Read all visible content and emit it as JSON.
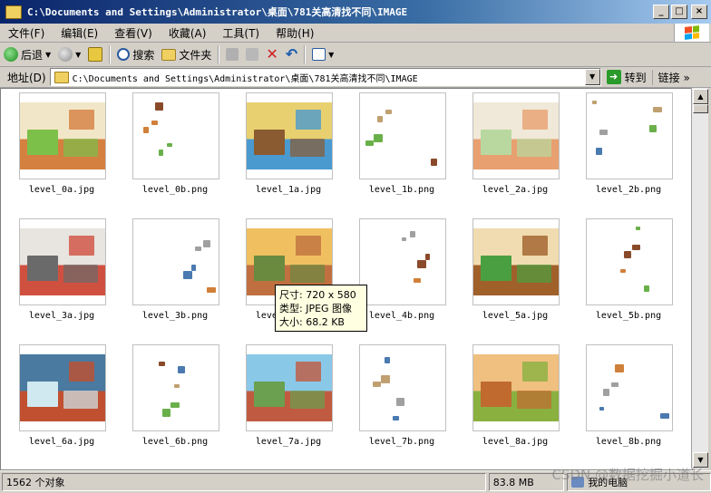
{
  "window": {
    "title": "C:\\Documents and Settings\\Administrator\\桌面\\781关高清找不同\\IMAGE",
    "minimize": "_",
    "maximize": "□",
    "close": "×"
  },
  "menu": [
    "文件(F)",
    "编辑(E)",
    "查看(V)",
    "收藏(A)",
    "工具(T)",
    "帮助(H)"
  ],
  "toolbar": {
    "back_label": "后退",
    "search_label": "搜索",
    "folders_label": "文件夹"
  },
  "address": {
    "label": "地址(D)",
    "path": "C:\\Documents and Settings\\Administrator\\桌面\\781关高清找不同\\IMAGE",
    "go_label": "转到",
    "links_label": "链接"
  },
  "files": [
    {
      "name": "level_0a.jpg",
      "kind": "scene",
      "palette": [
        "#f2e6c8",
        "#7cc04a",
        "#d48040"
      ]
    },
    {
      "name": "level_0b.png",
      "kind": "pieces"
    },
    {
      "name": "level_1a.jpg",
      "kind": "scene",
      "palette": [
        "#e8d070",
        "#8a5a30",
        "#4a9ad0"
      ]
    },
    {
      "name": "level_1b.png",
      "kind": "pieces"
    },
    {
      "name": "level_2a.jpg",
      "kind": "scene",
      "palette": [
        "#f0e8d8",
        "#b8d8a0",
        "#e8a070"
      ]
    },
    {
      "name": "level_2b.png",
      "kind": "pieces"
    },
    {
      "name": "level_3a.jpg",
      "kind": "scene",
      "palette": [
        "#e8e4e0",
        "#6a6a6a",
        "#d05040"
      ]
    },
    {
      "name": "level_3b.png",
      "kind": "pieces"
    },
    {
      "name": "level_4a.jpg",
      "kind": "scene",
      "palette": [
        "#f0c060",
        "#6a8a40",
        "#c07040"
      ]
    },
    {
      "name": "level_4b.png",
      "kind": "pieces"
    },
    {
      "name": "level_5a.jpg",
      "kind": "scene",
      "palette": [
        "#f0dcb0",
        "#4aa040",
        "#a0602a"
      ]
    },
    {
      "name": "level_5b.png",
      "kind": "pieces"
    },
    {
      "name": "level_6a.jpg",
      "kind": "scene",
      "palette": [
        "#4a7aa0",
        "#d0e8f0",
        "#c05030"
      ]
    },
    {
      "name": "level_6b.png",
      "kind": "pieces"
    },
    {
      "name": "level_7a.jpg",
      "kind": "scene",
      "palette": [
        "#8ac8e8",
        "#6aa050",
        "#c05a40"
      ]
    },
    {
      "name": "level_7b.png",
      "kind": "pieces"
    },
    {
      "name": "level_8a.jpg",
      "kind": "scene",
      "palette": [
        "#f0c080",
        "#c06a30",
        "#8ab040"
      ]
    },
    {
      "name": "level_8b.png",
      "kind": "pieces"
    }
  ],
  "tooltip": {
    "size": "尺寸: 720 x 580",
    "type": "类型: JPEG 图像",
    "filesize": "大小: 68.2 KB"
  },
  "status": {
    "count": "1562 个对象",
    "size": "83.8 MB",
    "zone": "我的电脑"
  },
  "watermark": "CSDN @数据挖掘小道长",
  "scroll": {
    "up": "▲",
    "down": "▼"
  }
}
